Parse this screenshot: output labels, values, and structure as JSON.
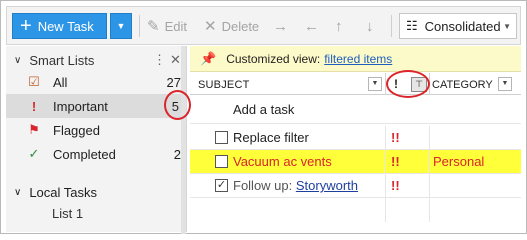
{
  "toolbar": {
    "new_task": "New Task",
    "edit": "Edit",
    "delete": "Delete",
    "view": "Consolidated"
  },
  "sidebar": {
    "smart_lists_title": "Smart Lists",
    "items": [
      {
        "label": "All",
        "count": "27",
        "icon": "clipboard-icon"
      },
      {
        "label": "Important",
        "count": "5",
        "icon": "exclamation-icon"
      },
      {
        "label": "Flagged",
        "count": "",
        "icon": "flag-icon"
      },
      {
        "label": "Completed",
        "count": "2",
        "icon": "checkmark-icon"
      }
    ],
    "local_tasks_title": "Local Tasks",
    "list1": "List 1"
  },
  "infobar": {
    "text": "Customized view:",
    "link": "filtered items"
  },
  "columns": {
    "subject": "SUBJECT",
    "priority": "!",
    "category": "CATEGORY"
  },
  "add_task": "Add a task",
  "tasks": [
    {
      "subject": "Replace filter",
      "priority": "!!",
      "category": "",
      "completed": false
    },
    {
      "subject": "Vacuum ac vents",
      "priority": "!!",
      "category": "Personal",
      "completed": false
    },
    {
      "subject_prefix": "Follow up: ",
      "subject_link": "Storyworth",
      "priority": "!!",
      "category": "",
      "completed": true
    }
  ],
  "colors": {
    "accent": "#2d95e5",
    "highlight": "#ffff3a",
    "priority": "#d9252b",
    "annotation": "#d9252b"
  }
}
